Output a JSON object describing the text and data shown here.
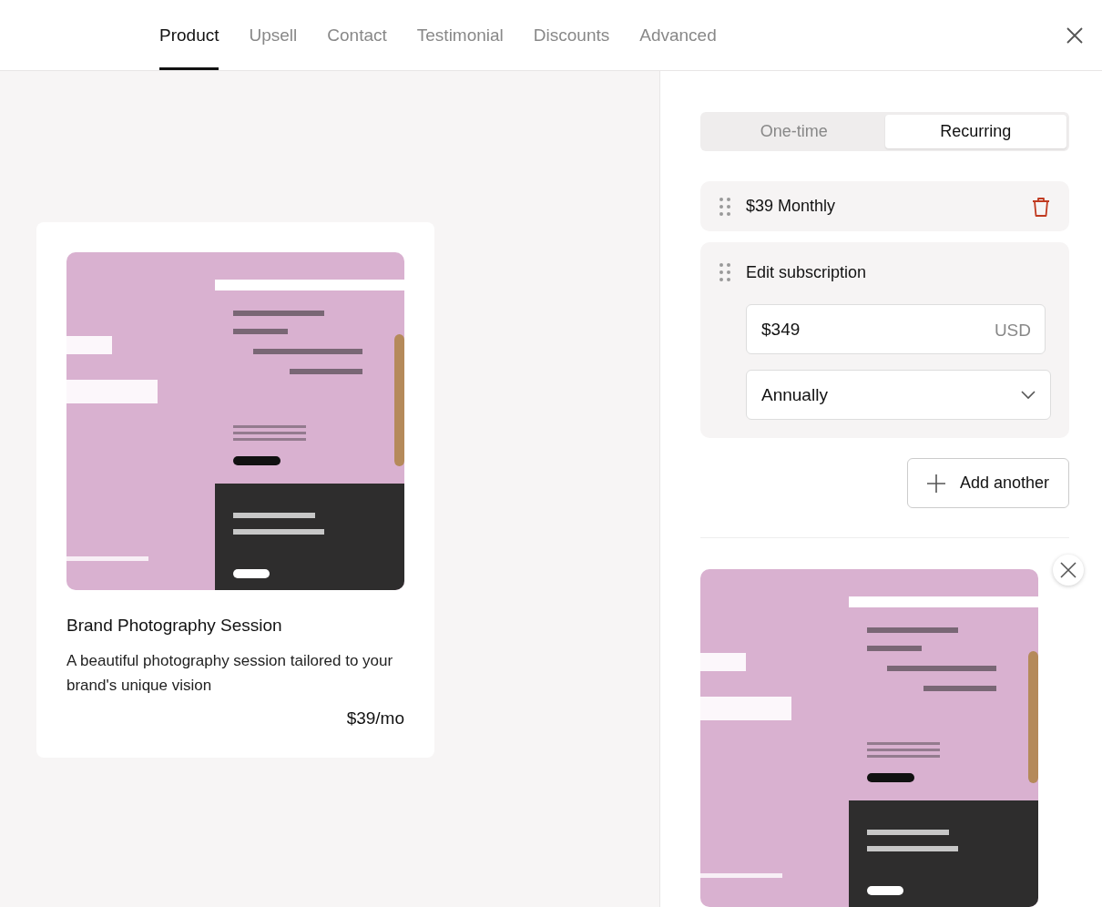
{
  "tabs": [
    {
      "label": "Product",
      "selected": true
    },
    {
      "label": "Upsell",
      "selected": false
    },
    {
      "label": "Contact",
      "selected": false
    },
    {
      "label": "Testimonial",
      "selected": false
    },
    {
      "label": "Discounts",
      "selected": false
    },
    {
      "label": "Advanced",
      "selected": false
    }
  ],
  "product_card": {
    "title": "Brand Photography Session",
    "description": "A beautiful photography session tailored to your brand's unique vision",
    "price": "$39/mo"
  },
  "pricing_type": [
    {
      "label": "One-time",
      "selected": false
    },
    {
      "label": "Recurring",
      "selected": true
    }
  ],
  "prices": [
    {
      "amount": "$39",
      "period": "Monthly"
    }
  ],
  "edit_subscription": {
    "title": "Edit subscription",
    "amount": "$349",
    "currency": "USD",
    "frequency": "Annually"
  },
  "add_button": "Add another"
}
